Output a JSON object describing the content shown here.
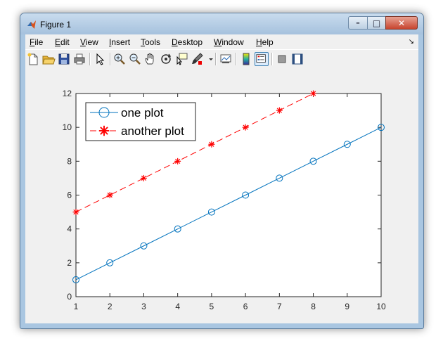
{
  "window": {
    "title": "Figure 1",
    "min_symbol": "–",
    "max_symbol": "□",
    "close_symbol": "✕"
  },
  "menu": {
    "file": {
      "key": "F",
      "rest": "ile"
    },
    "edit": {
      "key": "E",
      "rest": "dit"
    },
    "view": {
      "key": "V",
      "rest": "iew"
    },
    "insert": {
      "key": "I",
      "rest": "nsert"
    },
    "tools": {
      "key": "T",
      "rest": "ools"
    },
    "desktop": {
      "key": "D",
      "rest": "esktop"
    },
    "window": {
      "key": "W",
      "rest": "indow"
    },
    "help": {
      "key": "H",
      "rest": "elp"
    },
    "dock_arrow": "↘"
  },
  "toolbar": {
    "icons": [
      "new-figure-icon",
      "open-file-icon",
      "save-icon",
      "print-icon",
      "edit-plot-arrow-icon",
      "zoom-in-icon",
      "zoom-out-icon",
      "pan-hand-icon",
      "rotate-3d-icon",
      "data-cursor-icon",
      "brush-icon",
      "link-plot-icon",
      "insert-colorbar-icon",
      "insert-legend-icon",
      "hide-plot-tools-icon",
      "show-plot-tools-icon"
    ],
    "active_icon": "insert-legend-icon"
  },
  "chart_data": {
    "type": "line",
    "title": "",
    "xlabel": "",
    "ylabel": "",
    "xlim": [
      1,
      10
    ],
    "ylim": [
      0,
      12
    ],
    "xticks": [
      1,
      2,
      3,
      4,
      5,
      6,
      7,
      8,
      9,
      10
    ],
    "yticks": [
      0,
      2,
      4,
      6,
      8,
      10,
      12
    ],
    "grid": false,
    "legend_position": "top-left",
    "series": [
      {
        "name": "one plot",
        "x": [
          1,
          2,
          3,
          4,
          5,
          6,
          7,
          8,
          9,
          10
        ],
        "y": [
          1,
          2,
          3,
          4,
          5,
          6,
          7,
          8,
          9,
          10
        ],
        "color": "#0072bd",
        "line_style": "solid",
        "marker": "circle"
      },
      {
        "name": "another plot",
        "x": [
          1,
          2,
          3,
          4,
          5,
          6,
          7,
          8
        ],
        "y": [
          5,
          6,
          7,
          8,
          9,
          10,
          11,
          12
        ],
        "color": "#ff0000",
        "line_style": "dashed",
        "marker": "asterisk"
      }
    ]
  }
}
